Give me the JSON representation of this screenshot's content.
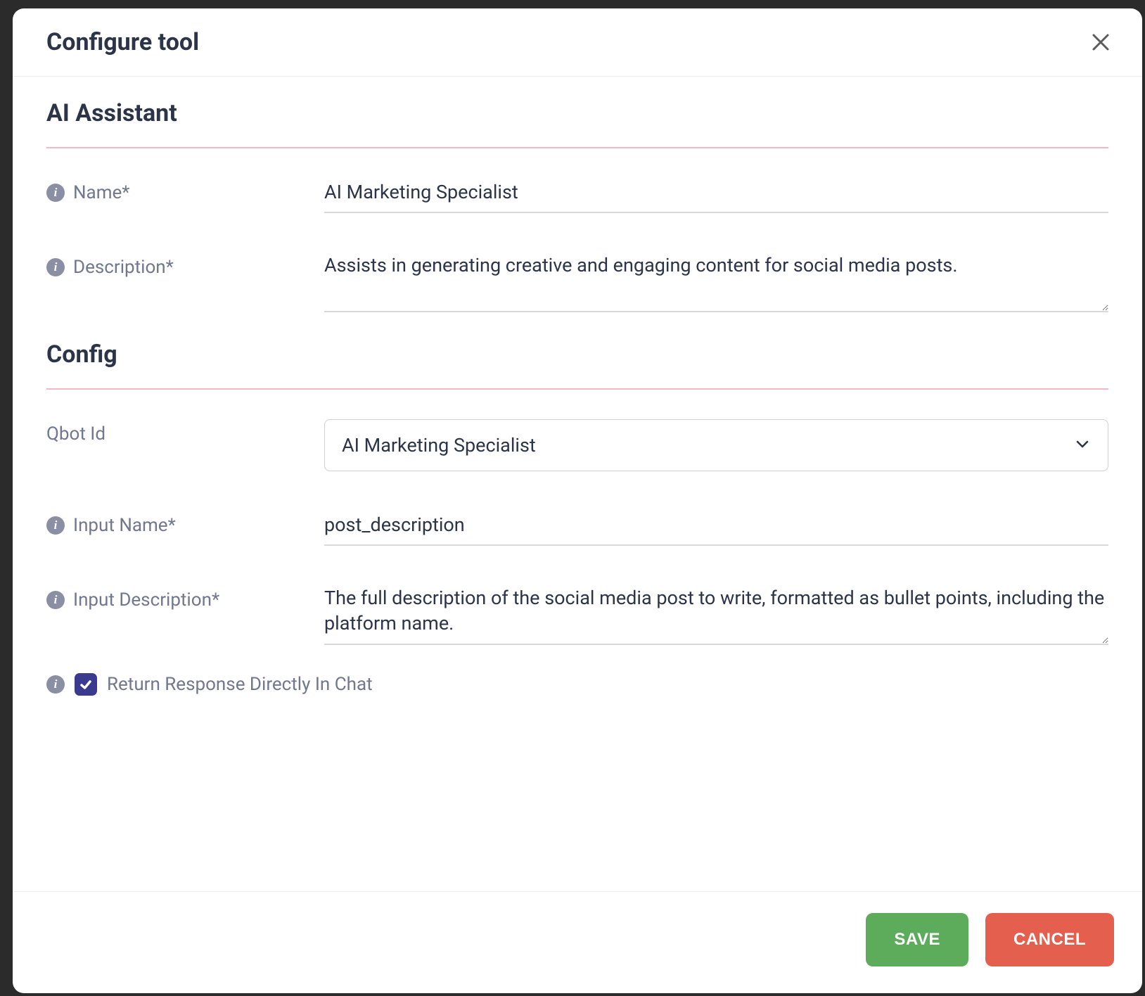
{
  "dialog": {
    "title": "Configure tool",
    "close_aria": "Close"
  },
  "sections": {
    "ai": "AI Assistant",
    "config": "Config"
  },
  "fields": {
    "name": {
      "label": "Name*",
      "value": "AI Marketing Specialist"
    },
    "description": {
      "label": "Description*",
      "value": "Assists in generating creative and engaging content for social media posts."
    },
    "qbot": {
      "label": "Qbot Id",
      "value": "AI Marketing Specialist"
    },
    "input_name": {
      "label": "Input Name*",
      "value": "post_description"
    },
    "input_description": {
      "label": "Input Description*",
      "value": "The full description of the social media post to write, formatted as bullet points, including the platform name."
    },
    "return_direct": {
      "label": "Return Response Directly In Chat",
      "checked": true
    }
  },
  "actions": {
    "save": "SAVE",
    "cancel": "CANCEL"
  }
}
